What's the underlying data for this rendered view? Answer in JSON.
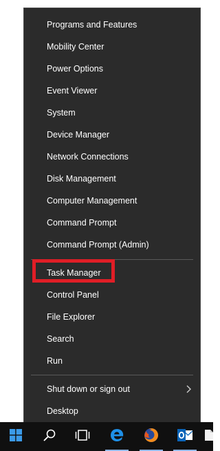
{
  "menu": {
    "items": [
      {
        "label": "Programs and Features"
      },
      {
        "label": "Mobility Center"
      },
      {
        "label": "Power Options"
      },
      {
        "label": "Event Viewer"
      },
      {
        "label": "System"
      },
      {
        "label": "Device Manager"
      },
      {
        "label": "Network Connections"
      },
      {
        "label": "Disk Management"
      },
      {
        "label": "Computer Management"
      },
      {
        "label": "Command Prompt"
      },
      {
        "label": "Command Prompt (Admin)"
      }
    ],
    "items2": [
      {
        "label": "Task Manager"
      },
      {
        "label": "Control Panel"
      },
      {
        "label": "File Explorer"
      },
      {
        "label": "Search"
      },
      {
        "label": "Run"
      }
    ],
    "items3": [
      {
        "label": "Shut down or sign out"
      },
      {
        "label": "Desktop"
      }
    ]
  },
  "colors": {
    "menu_background": "#2b2b2b",
    "highlight_border": "#e01e26",
    "taskbar": "#101010"
  },
  "taskbar": {
    "icons": [
      "windows-start-icon",
      "search-icon",
      "task-view-icon",
      "edge-icon",
      "firefox-icon",
      "outlook-icon"
    ]
  }
}
